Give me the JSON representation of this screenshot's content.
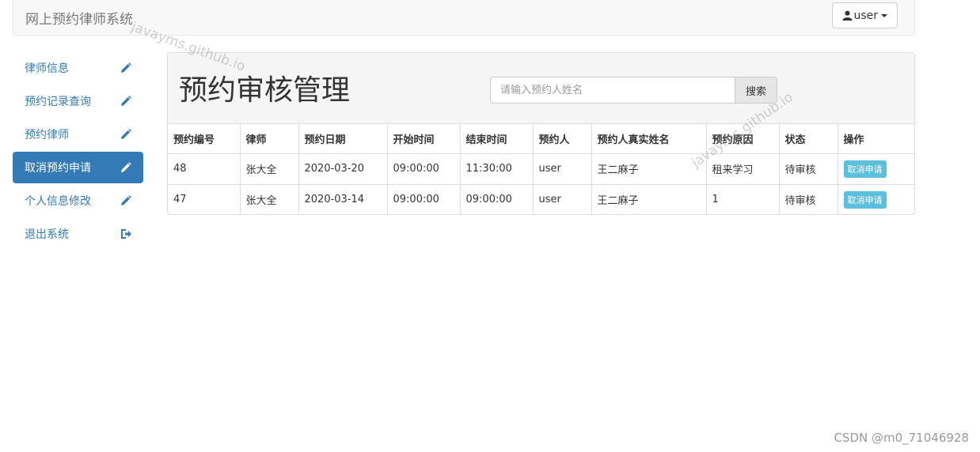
{
  "navbar": {
    "brand": "网上预约律师系统",
    "user_label": "user"
  },
  "sidebar": {
    "items": [
      {
        "label": "律师信息",
        "icon": "pencil-icon",
        "active": false
      },
      {
        "label": "预约记录查询",
        "icon": "pencil-icon",
        "active": false
      },
      {
        "label": "预约律师",
        "icon": "pencil-icon",
        "active": false
      },
      {
        "label": "取消预约申请",
        "icon": "pencil-icon",
        "active": true
      },
      {
        "label": "个人信息修改",
        "icon": "pencil-icon",
        "active": false
      },
      {
        "label": "退出系统",
        "icon": "logout-icon",
        "active": false
      }
    ]
  },
  "main": {
    "title": "预约审核管理",
    "search": {
      "placeholder": "请输入预约人姓名",
      "button_label": "搜索"
    },
    "table": {
      "columns": [
        "预约编号",
        "律师",
        "预约日期",
        "开始时间",
        "结束时间",
        "预约人",
        "预约人真实姓名",
        "预约原因",
        "状态",
        "操作"
      ],
      "rows": [
        [
          "48",
          "张大全",
          "2020-03-20",
          "09:00:00",
          "11:30:00",
          "user",
          "王二麻子",
          "租来学习",
          "待审核",
          "取消申请"
        ],
        [
          "47",
          "张大全",
          "2020-03-14",
          "09:00:00",
          "09:00:00",
          "user",
          "王二麻子",
          "1",
          "待审核",
          "取消申请"
        ]
      ]
    }
  },
  "watermarks": {
    "site": "javayms.github.io",
    "csdn": "CSDN @m0_71046928"
  },
  "colors": {
    "primary": "#337ab7",
    "info": "#5bc0de"
  }
}
